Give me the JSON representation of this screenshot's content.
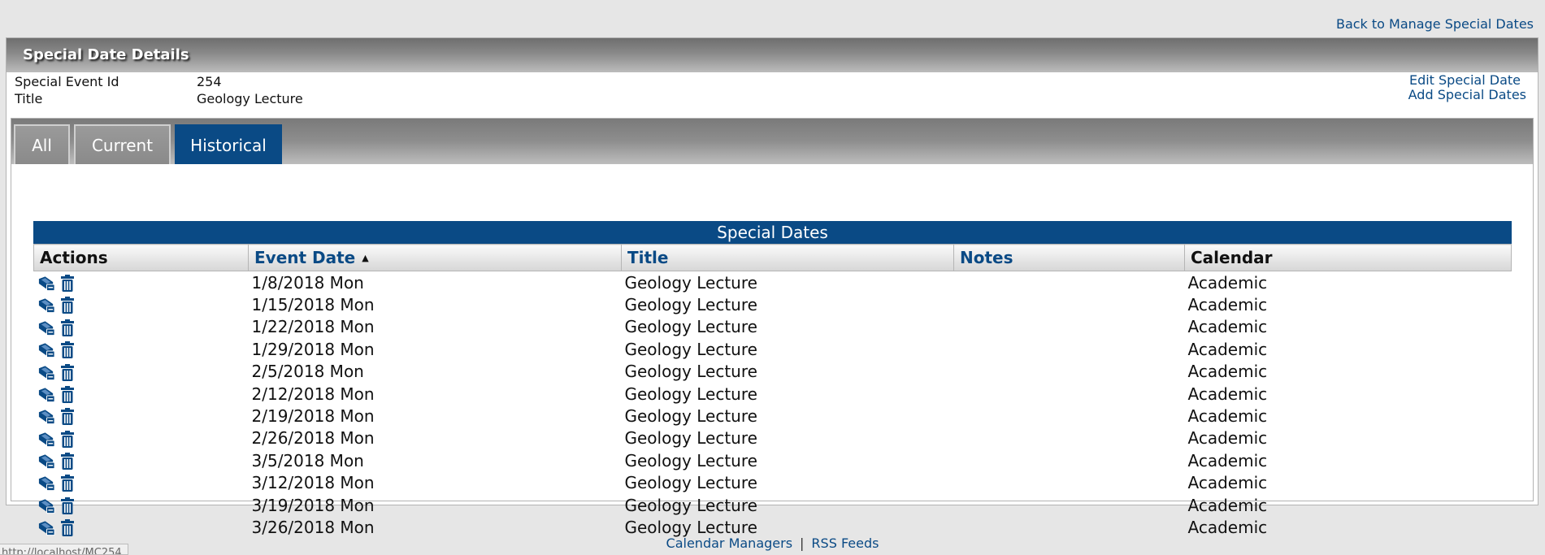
{
  "back_link": "Back to Manage Special Dates",
  "panel": {
    "title": "Special Date Details",
    "fields": [
      {
        "label": "Special Event Id",
        "value": "254"
      },
      {
        "label": "Title",
        "value": "Geology Lecture"
      }
    ],
    "links": [
      "Edit Special Date",
      "Add Special Dates"
    ]
  },
  "tabs": [
    {
      "label": "All",
      "active": false
    },
    {
      "label": "Current",
      "active": false
    },
    {
      "label": "Historical",
      "active": true
    }
  ],
  "grid": {
    "title": "Special Dates",
    "columns": [
      "Actions",
      "Event Date",
      "Title",
      "Notes",
      "Calendar"
    ],
    "sorted_column": "Event Date",
    "sort_direction": "ascending",
    "row_action_icons": [
      "edit-icon",
      "delete-icon"
    ],
    "rows": [
      {
        "date": "1/8/2018 Mon",
        "title": "Geology Lecture",
        "notes": "",
        "calendar": "Academic"
      },
      {
        "date": "1/15/2018 Mon",
        "title": "Geology Lecture",
        "notes": "",
        "calendar": "Academic"
      },
      {
        "date": "1/22/2018 Mon",
        "title": "Geology Lecture",
        "notes": "",
        "calendar": "Academic"
      },
      {
        "date": "1/29/2018 Mon",
        "title": "Geology Lecture",
        "notes": "",
        "calendar": "Academic"
      },
      {
        "date": "2/5/2018 Mon",
        "title": "Geology Lecture",
        "notes": "",
        "calendar": "Academic"
      },
      {
        "date": "2/12/2018 Mon",
        "title": "Geology Lecture",
        "notes": "",
        "calendar": "Academic"
      },
      {
        "date": "2/19/2018 Mon",
        "title": "Geology Lecture",
        "notes": "",
        "calendar": "Academic"
      },
      {
        "date": "2/26/2018 Mon",
        "title": "Geology Lecture",
        "notes": "",
        "calendar": "Academic"
      },
      {
        "date": "3/5/2018 Mon",
        "title": "Geology Lecture",
        "notes": "",
        "calendar": "Academic"
      },
      {
        "date": "3/12/2018 Mon",
        "title": "Geology Lecture",
        "notes": "",
        "calendar": "Academic"
      },
      {
        "date": "3/19/2018 Mon",
        "title": "Geology Lecture",
        "notes": "",
        "calendar": "Academic"
      },
      {
        "date": "3/26/2018 Mon",
        "title": "Geology Lecture",
        "notes": "",
        "calendar": "Academic"
      }
    ]
  },
  "footer": {
    "links": [
      "Calendar Managers",
      "RSS Feeds"
    ],
    "separator": "|"
  },
  "status_bar": {
    "url": "http://localhost/MC254"
  },
  "colors": {
    "accent": "#0a4a85",
    "header_gray": "#8a8a8a",
    "background": "#e6e6e6"
  }
}
